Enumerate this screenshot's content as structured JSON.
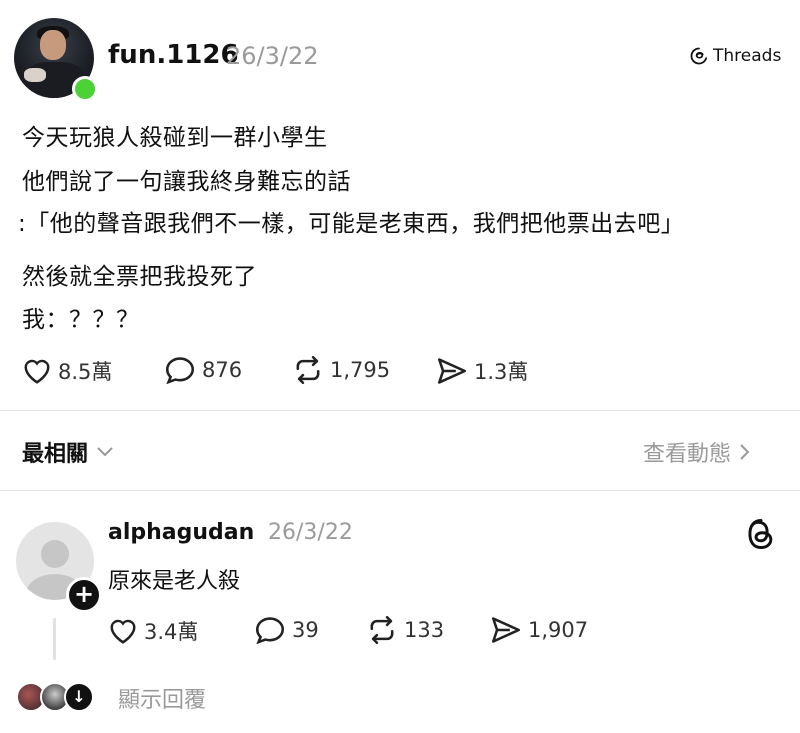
{
  "post": {
    "username": "fun.1126",
    "date": "26/3/22",
    "brand": "Threads",
    "lines": [
      "今天玩狼人殺碰到一群小學生",
      "他們說了一句讓我終身難忘的話",
      ":「他的聲音跟我們不一樣，可能是老東西，我們把他票出去吧」",
      "然後就全票把我投死了",
      "我：？？？"
    ],
    "likes": "8.5萬",
    "comments": "876",
    "reposts": "1,795",
    "shares": "1.3萬"
  },
  "sort": {
    "label": "最相關",
    "view_activity": "查看動態"
  },
  "reply": {
    "username": "alphagudan",
    "date": "26/3/22",
    "text": "原來是老人殺",
    "likes": "3.4萬",
    "comments": "39",
    "reposts": "133",
    "shares": "1,907",
    "show_replies": "顯示回覆"
  },
  "colors": {
    "online": "#4cd137",
    "muted": "#9a9a9a",
    "text": "#111111"
  }
}
